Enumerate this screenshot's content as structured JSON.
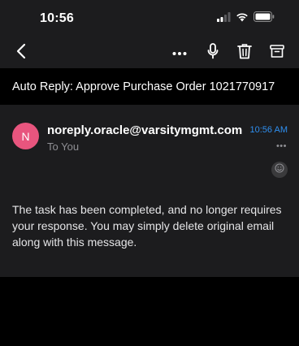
{
  "status_bar": {
    "time": "10:56",
    "icons": [
      "cellular-signal-icon",
      "wifi-icon",
      "battery-icon"
    ]
  },
  "toolbar": {
    "icons": [
      "back-chevron-icon",
      "more-horizontal-icon",
      "microphone-icon",
      "trash-icon",
      "archive-icon"
    ]
  },
  "email": {
    "subject": "Auto Reply: Approve Purchase Order 1021770917",
    "avatar_initial": "N",
    "sender": "noreply.oracle@varsitymgmt.com",
    "time": "10:56 AM",
    "recipient": "To You",
    "more_label": "•••",
    "body": "The task has been completed, and no longer requires your response. You may simply delete original email along with this message."
  },
  "colors": {
    "background": "#000000",
    "card": "#1c1c1e",
    "avatar": "#e8557e",
    "accent_time": "#2f8ff0",
    "secondary_text": "#8e8e93"
  }
}
